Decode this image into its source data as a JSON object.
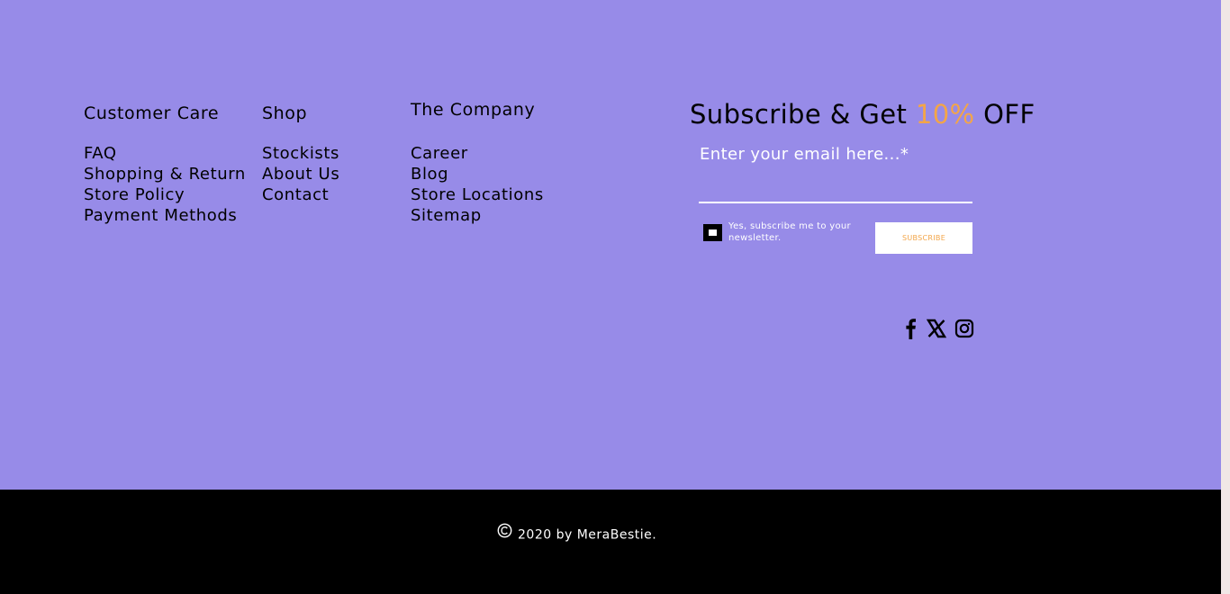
{
  "footer": {
    "columns": {
      "customer_care": {
        "heading": "Customer Care",
        "links": [
          "FAQ",
          "Shopping & Return",
          "Store Policy",
          "Payment Methods"
        ]
      },
      "shop": {
        "heading": "Shop",
        "links": [
          "Stockists",
          "About Us",
          "Contact"
        ]
      },
      "company": {
        "heading": "The Company",
        "links": [
          "Career",
          "Blog",
          "Store Locations",
          "Sitemap"
        ]
      }
    },
    "subscribe": {
      "title_pre": "Subscribe & Get ",
      "title_highlight": "10%",
      "title_post": " OFF",
      "email_label": "Enter your email here...*",
      "email_value": "",
      "checkbox_label": "Yes, subscribe me to your newsletter.",
      "checkbox_checked": false,
      "button_label": "SUBSCRIBE"
    },
    "social": [
      {
        "name": "facebook",
        "icon": "facebook-icon"
      },
      {
        "name": "x",
        "icon": "x-icon"
      },
      {
        "name": "instagram",
        "icon": "instagram-icon"
      }
    ],
    "copyright": {
      "icon": "copyright-icon",
      "text": "2020 by MeraBestie."
    }
  },
  "colors": {
    "footer_background": "#978be8",
    "bottom_bar_background": "#000000",
    "accent": "#f3a548",
    "text": "#000000",
    "inverse_text": "#ffffff"
  }
}
